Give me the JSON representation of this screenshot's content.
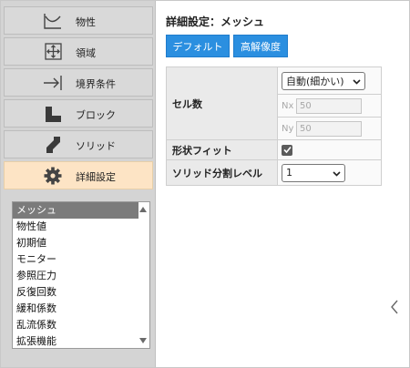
{
  "sidebar": {
    "items": [
      {
        "label": "物性",
        "icon": "graph-curve-icon"
      },
      {
        "label": "領域",
        "icon": "domain-expand-icon"
      },
      {
        "label": "境界条件",
        "icon": "boundary-arrow-icon"
      },
      {
        "label": "ブロック",
        "icon": "block-icon"
      },
      {
        "label": "ソリッド",
        "icon": "solid-icon"
      },
      {
        "label": "詳細設定",
        "icon": "gear-icon",
        "active": true
      }
    ],
    "list": {
      "selected": "メッシュ",
      "items": [
        "メッシュ",
        "物性値",
        "初期値",
        "モニター",
        "参照圧力",
        "反復回数",
        "緩和係数",
        "乱流係数",
        "拡張機能"
      ]
    }
  },
  "main": {
    "title": "詳細設定：メッシュ",
    "buttons": {
      "default_label": "デフォルト",
      "hires_label": "高解像度"
    },
    "settings": {
      "cell_count": {
        "label": "セル数",
        "select_value": "自動(細かい)",
        "nx_label": "Nx",
        "nx_value": "50",
        "ny_label": "Ny",
        "ny_value": "50"
      },
      "shape_fit": {
        "label": "形状フィット",
        "checked": true
      },
      "solid_level": {
        "label": "ソリッド分割レベル",
        "select_value": "1"
      }
    }
  },
  "colors": {
    "accent": "#2b8fe0",
    "active_nav": "#fde4c5",
    "list_selected": "#7b7b7b"
  }
}
